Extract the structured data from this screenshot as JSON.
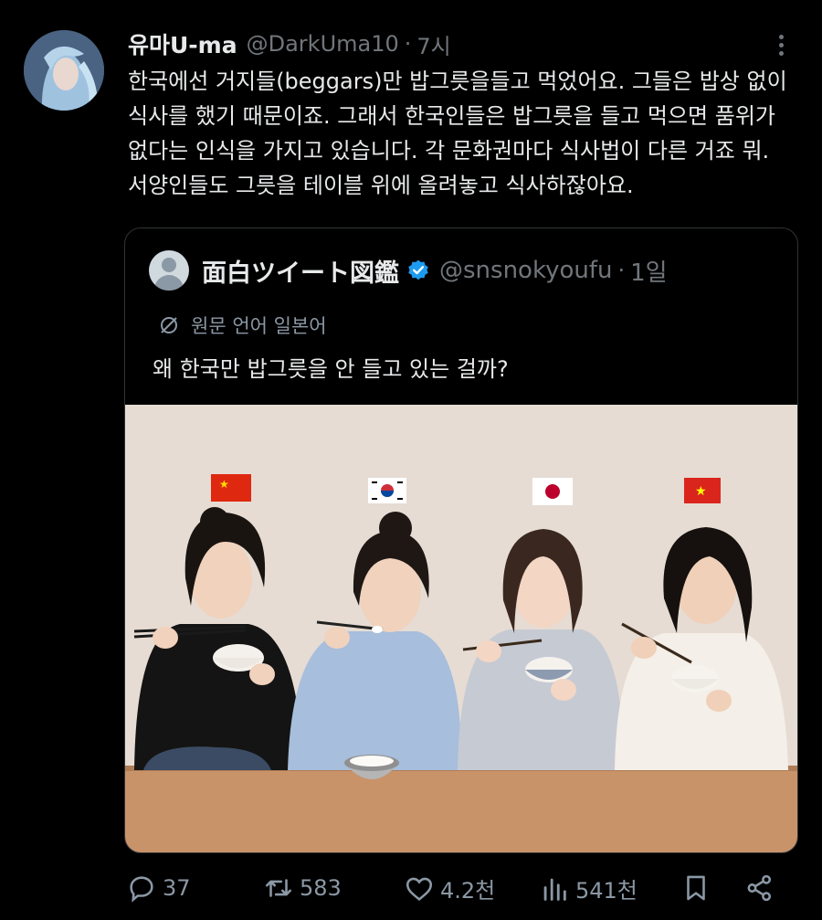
{
  "tweet": {
    "author_name": "유마U-ma",
    "handle": "@DarkUma10",
    "separator": "·",
    "time": "7시",
    "text_lines": [
      "한국에선 거지들(beggars)만 밥그릇을들고 먹었어요. 그들은 밥상 없이",
      "식사를 했기 때문이죠. 그래서 한국인들은 밥그릇을 들고 먹으면 품위가",
      "없다는 인식을 가지고 있습니다. 각 문화권마다 식사법이 다른 거죠 뭐.",
      "서양인들도 그릇을 테이블 위에 올려놓고 식사하잖아요."
    ]
  },
  "quote": {
    "author_name": "面白ツイート図鑑",
    "handle": "@snsnokyoufu",
    "separator": "·",
    "time": "1일",
    "translation_note": "원문 언어 일본어",
    "text": "왜 한국만 밥그릇을 안 들고 있는 걸까?"
  },
  "actions": {
    "replies": "37",
    "reposts": "583",
    "likes": "4.2천",
    "views": "541천"
  },
  "colors": {
    "background": "#000000",
    "text": "#e7e9ea",
    "muted": "#71767b",
    "verified": "#1d9bf0"
  }
}
